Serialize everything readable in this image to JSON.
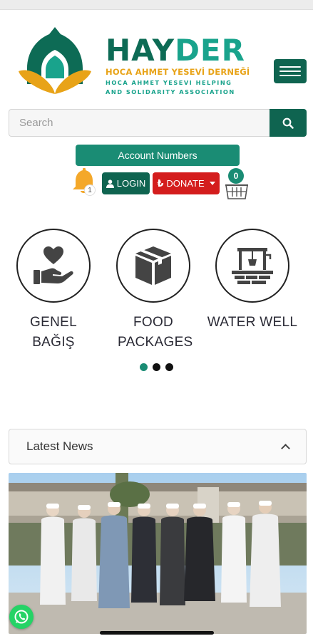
{
  "brand": {
    "name_part1": "HAY",
    "name_part2": "DER",
    "line1": "HOCA AHMET YESEVİ DERNEĞİ",
    "line2a": "HOCA AHMET YESEVI HELPING",
    "line2b": "AND SOLIDARITY ASSOCIATION"
  },
  "search": {
    "placeholder": "Search"
  },
  "account_numbers_label": "Account Numbers",
  "notifications": {
    "count": "1"
  },
  "login_label": "LOGIN",
  "donate_label": "DONATE",
  "cart": {
    "count": "0"
  },
  "categories": [
    {
      "label": "GENEL BAĞIŞ",
      "icon": "hand-heart-icon"
    },
    {
      "label": "FOOD PACKAGES",
      "icon": "box-icon"
    },
    {
      "label": "WATER WELL",
      "icon": "water-well-icon"
    }
  ],
  "carousel": {
    "pages": 3,
    "active": 1
  },
  "news": {
    "header": "Latest News"
  },
  "colors": {
    "primary": "#0f6450",
    "accent": "#1a8c74",
    "gold": "#e8a318",
    "danger": "#d41d1d"
  }
}
